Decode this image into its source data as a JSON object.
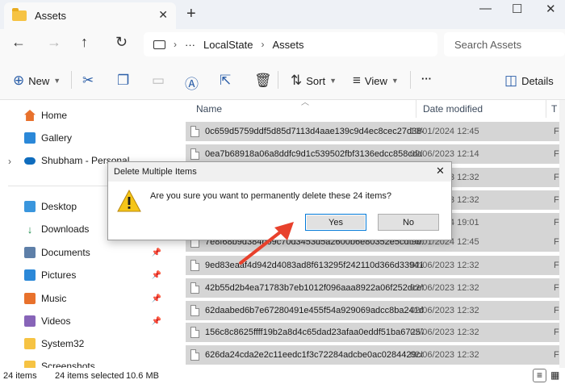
{
  "window": {
    "tab_title": "Assets",
    "tab_close": "✕",
    "new_tab": "+",
    "minimize": "—",
    "maximize": "☐",
    "close": "✕"
  },
  "nav": {
    "back": "←",
    "forward": "→",
    "up": "↑",
    "refresh": "↻",
    "more": "···",
    "crumbs": [
      "LocalState",
      "Assets"
    ],
    "search_placeholder": "Search Assets"
  },
  "toolbar": {
    "new_label": "New",
    "sort_label": "Sort",
    "view_label": "View",
    "more": "···",
    "details_label": "Details"
  },
  "sidebar": {
    "top": [
      {
        "label": "Home",
        "icon": "home-icon"
      },
      {
        "label": "Gallery",
        "icon": "gallery-icon"
      },
      {
        "label": "Shubham - Personal",
        "icon": "cloud-icon"
      }
    ],
    "quick": [
      {
        "label": "Desktop",
        "icon": "desktop-icon"
      },
      {
        "label": "Downloads",
        "icon": "downloads-icon"
      },
      {
        "label": "Documents",
        "icon": "documents-icon"
      },
      {
        "label": "Pictures",
        "icon": "pictures-icon"
      },
      {
        "label": "Music",
        "icon": "music-icon"
      },
      {
        "label": "Videos",
        "icon": "videos-icon"
      },
      {
        "label": "System32",
        "icon": "folder-icon"
      },
      {
        "label": "Screenshots",
        "icon": "folder-icon"
      }
    ]
  },
  "columns": {
    "name": "Name",
    "date": "Date modified",
    "type": "T"
  },
  "files": [
    {
      "name": "0c659d5759ddf5d85d7113d4aae139c9d4ec8cec27d384...",
      "date": "13/01/2024 12:45",
      "type": "F"
    },
    {
      "name": "0ea7b68918a06a8ddfc9d1c539502fbf3136edcc858cda6...",
      "date": "02/06/2023 12:14",
      "type": "F"
    },
    {
      "name": "",
      "date": "02/06/2023 12:32",
      "type": "F"
    },
    {
      "name": "",
      "date": "02/06/2023 12:32",
      "type": "F"
    },
    {
      "name": "",
      "date": "13/01/2024 19:01",
      "type": "F"
    },
    {
      "name": "7e8f68b9d384b09c70d3453d5a2600b6e80352e5cdf9b...",
      "date": "13/01/2024 12:45",
      "type": "F"
    },
    {
      "name": "9ed83eaaf4d942d4083ad8f613295f242110d366d339411...",
      "date": "02/06/2023 12:32",
      "type": "F"
    },
    {
      "name": "42b55d2b4ea71783b7eb1012f096aaa8922a06f252dceff...",
      "date": "02/06/2023 12:32",
      "type": "F"
    },
    {
      "name": "62daabed6b7e67280491e455f54a929069adcc8ba241dc...",
      "date": "02/06/2023 12:32",
      "type": "F"
    },
    {
      "name": "156c8c8625ffff19b2a8d4c65dad23afaa0eddf51ba67257...",
      "date": "02/06/2023 12:32",
      "type": "F"
    },
    {
      "name": "626da24cda2e2c11eedc1f3c72284adcbe0ac0284429cd...",
      "date": "02/06/2023 12:32",
      "type": "F"
    }
  ],
  "status": {
    "count": "24 items",
    "selected": "24 items selected",
    "size": "10.6 MB"
  },
  "dialog": {
    "title": "Delete Multiple Items",
    "message": "Are you sure you want to permanently delete these 24 items?",
    "yes": "Yes",
    "no": "No",
    "close": "✕"
  },
  "colors": {
    "accent": "#0078d7",
    "selection": "#d5d5d5",
    "warning": "#f5c518",
    "arrow": "#e8412c"
  }
}
